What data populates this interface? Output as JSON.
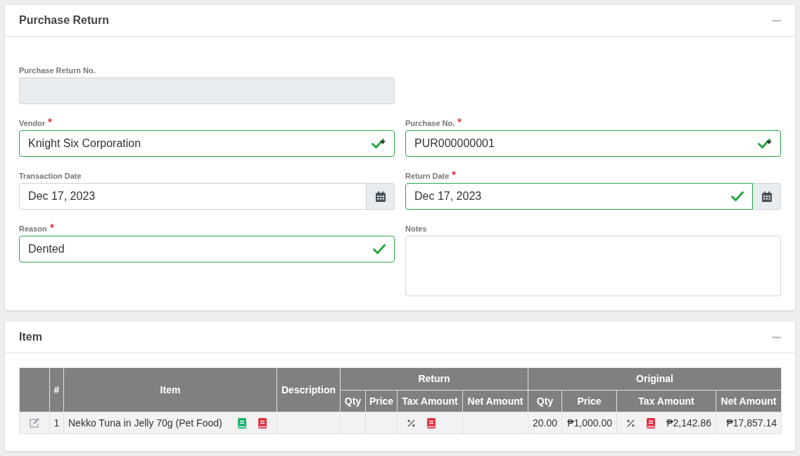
{
  "form_panel": {
    "title": "Purchase Return",
    "rows": [
      [
        {
          "label": "Purchase Return No.",
          "kind": "text",
          "required": false,
          "disabled": true,
          "valid": false
        }
      ],
      [
        {
          "label": "Vendor",
          "kind": "select",
          "required": true,
          "disabled": false,
          "valid": true,
          "value": "Knight Six Corporation"
        },
        {
          "label": "Purchase No.",
          "kind": "select",
          "required": true,
          "disabled": false,
          "valid": true,
          "value": "PUR000000001"
        }
      ],
      [
        {
          "label": "Transaction Date",
          "kind": "date",
          "required": false,
          "disabled": false,
          "valid": false,
          "value": "Dec 17, 2023"
        },
        {
          "label": "Return Date",
          "kind": "date",
          "required": true,
          "disabled": false,
          "valid": true,
          "value": "Dec 17, 2023"
        }
      ],
      [
        {
          "label": "Reason",
          "kind": "text",
          "required": true,
          "disabled": false,
          "valid": true,
          "value": "Dented"
        },
        {
          "label": "Notes",
          "kind": "textarea",
          "required": false,
          "disabled": false,
          "valid": false
        }
      ]
    ]
  },
  "item_panel": {
    "title": "Item",
    "table": {
      "columns": [
        "#",
        "Item",
        "Description"
      ],
      "groups": [
        {
          "label": "Return",
          "columns": [
            "Qty",
            "Price",
            "Tax Amount",
            "Net Amount"
          ]
        },
        {
          "label": "Original",
          "columns": [
            "Qty",
            "Price",
            "Tax Amount",
            "Net Amount"
          ]
        }
      ],
      "rows": [
        {
          "number": "1",
          "item": "Nekko Tuna in Jelly 70g (Pet Food)",
          "original": {
            "qty": "20.00",
            "price": "₱1,000.00",
            "tax_amount": "₱2,142.86",
            "net_amount": "₱17,857.14"
          }
        }
      ]
    }
  }
}
